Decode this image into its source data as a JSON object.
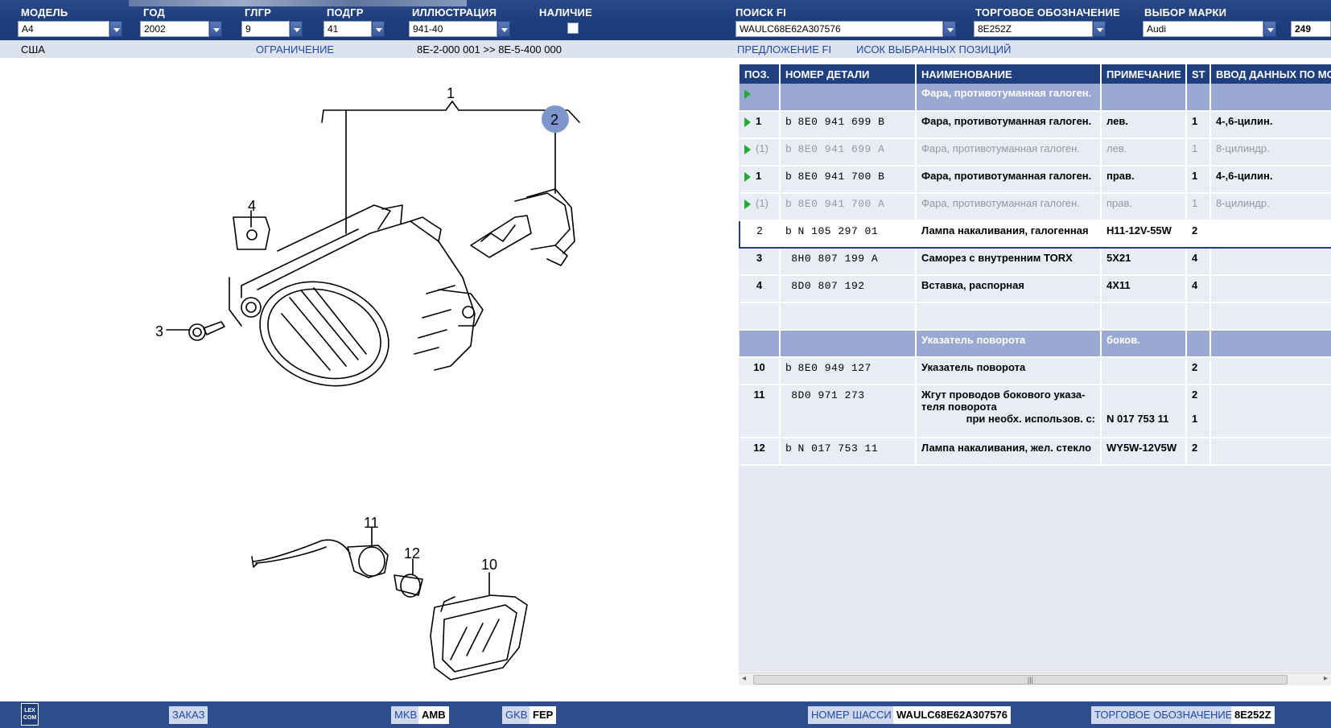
{
  "header": {
    "labels": {
      "model": "МОДЕЛЬ",
      "year": "ГОД",
      "mgroup": "ГЛГР",
      "subgroup": "ПОДГР",
      "illustration": "ИЛЛЮСТРАЦИЯ",
      "availability": "НАЛИЧИЕ",
      "search_fi": "ПОИСК FI",
      "trade_name": "ТОРГОВОЕ ОБОЗНАЧЕНИЕ",
      "brand_select": "ВЫБОР МАРКИ"
    },
    "values": {
      "model": "A4",
      "year": "2002",
      "mgroup": "9",
      "subgroup": "41",
      "illustration": "941-40",
      "search_fi": "WAULC68E62A307576",
      "trade_name": "8E252Z",
      "brand": "Audi",
      "count": "249"
    }
  },
  "subbar": {
    "market": "США",
    "restriction": "ОГРАНИЧЕНИЕ",
    "range": "8E-2-000 001 >> 8E-5-400 000",
    "proposal": "ПРЕДЛОЖЕНИЕ FI",
    "selected_list": "ИСОК ВЫБРАННЫХ ПОЗИЦИЙ"
  },
  "table": {
    "columns": [
      "ПОЗ.",
      "НОМЕР ДЕТАЛИ",
      "НАИМЕНОВАНИЕ",
      "ПРИМЕЧАНИЕ",
      "ST",
      "ВВОД ДАННЫХ ПО МО"
    ],
    "rows": [
      {
        "type": "group",
        "arrow": true,
        "pos": "",
        "b": "",
        "part": "",
        "name": "Фара, противотуманная галоген.",
        "note": "",
        "st": "",
        "data": ""
      },
      {
        "type": "normal",
        "arrow": true,
        "pos": "1",
        "b": "b",
        "part": "8E0 941 699 B",
        "name": "Фара, противотуманная галоген.",
        "note": "лев.",
        "st": "1",
        "data": "4-,6-цилин."
      },
      {
        "type": "dim",
        "arrow": true,
        "pos": "(1)",
        "b": "b",
        "part": "8E0 941 699 A",
        "name": "Фара, противотуманная галоген.",
        "note": "лев.",
        "st": "1",
        "data": "8-цилиндр."
      },
      {
        "type": "normal",
        "arrow": true,
        "pos": "1",
        "b": "b",
        "part": "8E0 941 700 B",
        "name": "Фара, противотуманная галоген.",
        "note": "прав.",
        "st": "1",
        "data": "4-,6-цилин."
      },
      {
        "type": "dim",
        "arrow": true,
        "pos": "(1)",
        "b": "b",
        "part": "8E0 941 700 A",
        "name": "Фара, противотуманная галоген.",
        "note": "прав.",
        "st": "1",
        "data": "8-цилиндр."
      },
      {
        "type": "sel",
        "arrow": false,
        "pos": "2",
        "b": "b",
        "part": "N    105 297 01",
        "name": "Лампа накаливания, галогенная",
        "note": "H11-12V-55W",
        "st": "2",
        "data": ""
      },
      {
        "type": "normal",
        "arrow": false,
        "pos": "3",
        "b": "",
        "part": "8H0 807 199 A",
        "name": "Саморез с внутренним TORX",
        "note": "5X21",
        "st": "4",
        "data": ""
      },
      {
        "type": "normal",
        "arrow": false,
        "pos": "4",
        "b": "",
        "part": "8D0 807 192",
        "name": "Вставка, распорная",
        "note": "4X11",
        "st": "4",
        "data": ""
      },
      {
        "type": "empty",
        "arrow": false,
        "pos": "",
        "b": "",
        "part": "",
        "name": "",
        "note": "",
        "st": "",
        "data": ""
      },
      {
        "type": "group",
        "arrow": false,
        "pos": "",
        "b": "",
        "part": "",
        "name": "Указатель поворота",
        "note": "боков.",
        "st": "",
        "data": ""
      },
      {
        "type": "normal",
        "arrow": false,
        "pos": "10",
        "b": "b",
        "part": "8E0 949 127",
        "name": "Указатель поворота",
        "note": "",
        "st": "2",
        "data": ""
      },
      {
        "type": "multi",
        "arrow": false,
        "pos": "11",
        "b": "",
        "part": "8D0 971 273",
        "name": "Жгут проводов бокового указа-",
        "name2": "теля поворота",
        "name3": "при необх. использов. с:",
        "note": "",
        "note3": "N   017 753 11",
        "st": "2",
        "st3": "1",
        "data": ""
      },
      {
        "type": "normal",
        "arrow": false,
        "pos": "12",
        "b": "b",
        "part": "N    017 753 11",
        "name": "Лампа накаливания, жел. стекло",
        "note": "WY5W-12V5W",
        "st": "2",
        "data": ""
      }
    ]
  },
  "illustration": {
    "callouts": [
      "1",
      "2",
      "3",
      "4",
      "10",
      "11",
      "12"
    ]
  },
  "footer": {
    "order": "ЗАКАЗ",
    "mkb_label": "MKB",
    "mkb_value": "AMB",
    "gkb_label": "GKB",
    "gkb_value": "FEP",
    "chassis_label": "НОМЕР ШАССИ",
    "chassis_value": "WAULC68E62A307576",
    "trade_label": "ТОРГОВОЕ ОБОЗНАЧЕНИЕ",
    "trade_value": "8E252Z",
    "logo_top": "LEX",
    "logo_bottom": "COM"
  },
  "colors": {
    "header_bg": "#1f3f7f",
    "group_row": "#9aa9d2",
    "row_bg": "#e8ecf5",
    "link": "#1f4aa8",
    "arrow": "#22aa33",
    "callout_highlight": "#7f96cc"
  }
}
